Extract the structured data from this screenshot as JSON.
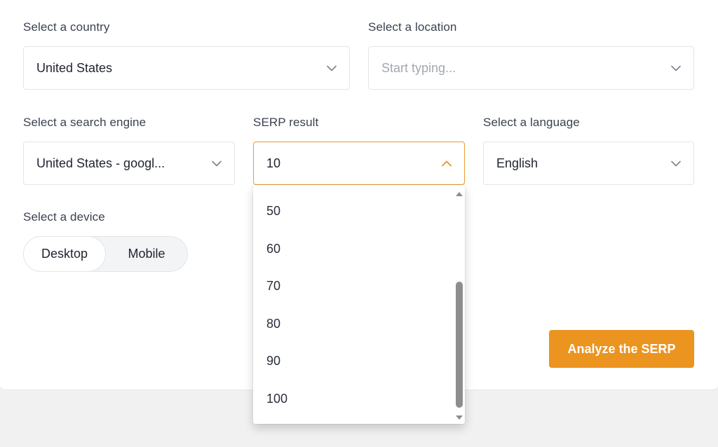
{
  "country": {
    "label": "Select a country",
    "value": "United States"
  },
  "location": {
    "label": "Select a location",
    "placeholder": "Start typing..."
  },
  "search_engine": {
    "label": "Select a search engine",
    "value": "United States - googl..."
  },
  "serp_result": {
    "label": "SERP result",
    "value": "10",
    "options": [
      "50",
      "60",
      "70",
      "80",
      "90",
      "100"
    ]
  },
  "language": {
    "label": "Select a language",
    "value": "English"
  },
  "device": {
    "label": "Select a device",
    "options": [
      "Desktop",
      "Mobile"
    ],
    "selected": "Desktop"
  },
  "analyze_button": "Analyze the SERP",
  "colors": {
    "accent": "#eb9420",
    "open_border": "#ec9a2c"
  }
}
